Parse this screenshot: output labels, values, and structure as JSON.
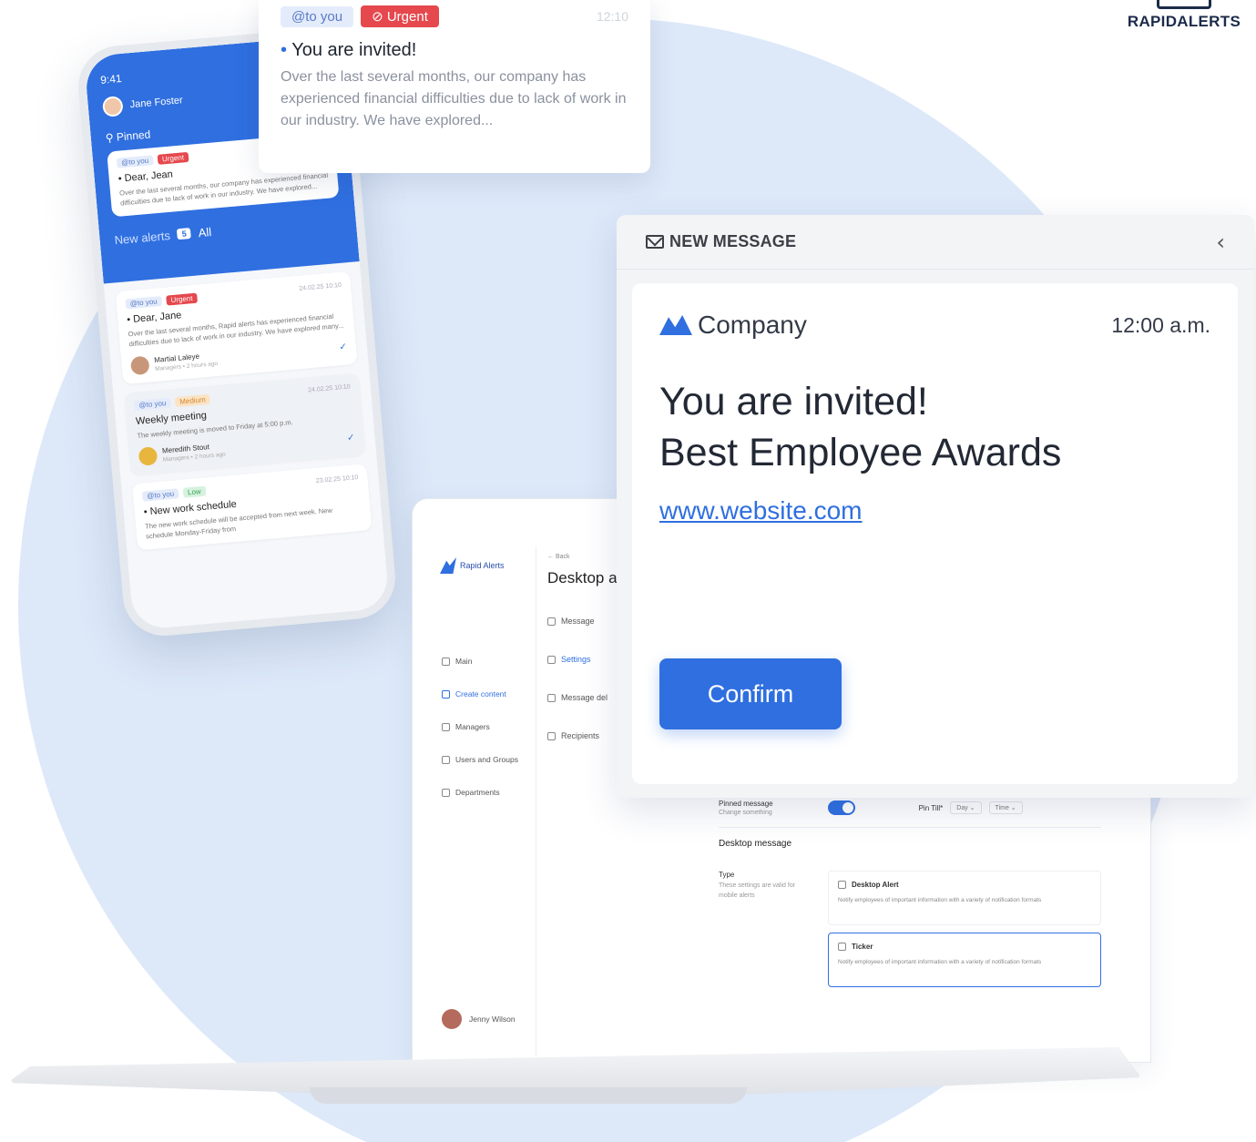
{
  "brand": {
    "name": "RAPIDALERTS"
  },
  "notification": {
    "tag_to": "@to you",
    "tag_urgent": "Urgent",
    "time": "12:10",
    "title": "You are invited!",
    "body": "Over the last several months, our company has experienced financial difficulties due to lack of work in our industry. We have explored..."
  },
  "phone": {
    "time": "9:41",
    "user": "Jane Foster",
    "pinned_label": "Pinned",
    "pinned": {
      "tag_to": "@to you",
      "tag_urgent": "Urgent",
      "title": "Dear, Jean",
      "body": "Over the last several months, our company has experienced financial difficulties due to lack of work in our industry. We have explored..."
    },
    "new_alerts_label": "New alerts",
    "new_alerts_count": "5",
    "all_label": "All",
    "alerts": [
      {
        "tag_to": "@to you",
        "tag_level": "Urgent",
        "date": "24.02.25 10:10",
        "title": "Dear, Jane",
        "body": "Over the last several months, Rapid alerts has experienced financial difficulties due to lack of work in our industry. We have explored many...",
        "author": "Martial Laleye",
        "author_meta": "Managers • 2 hours ago"
      },
      {
        "tag_to": "@to you",
        "tag_level": "Medium",
        "date": "24.02.25 10:10",
        "title": "Weekly meeting",
        "body": "The weekly meeting is moved to Friday at 5:00 p.m.",
        "author": "Meredith Stout",
        "author_meta": "Managers • 2 hours ago"
      },
      {
        "tag_to": "@to you",
        "tag_level": "Low",
        "date": "23.02.25 10:10",
        "title": "New work schedule",
        "body": "The new work schedule will be accepted from next week. New schedule Monday-Friday from"
      }
    ]
  },
  "laptop": {
    "logo": "Rapid Alerts",
    "nav": [
      "Main",
      "Create content",
      "Managers",
      "Users and Groups",
      "Departments"
    ],
    "user": "Jenny Wilson",
    "back": "← Back",
    "heading": "Desktop a",
    "sub_nav": [
      "Message",
      "Settings",
      "Message del",
      "Recipients"
    ],
    "pinned_message": "Pinned message",
    "change_something": "Change something",
    "pin_till": "Pin Till*",
    "day": "Day",
    "time": "Time",
    "section_title": "Desktop message",
    "type_label": "Type",
    "type_note": "These settings are valid for mobile alerts",
    "options": [
      {
        "title": "Desktop Alert",
        "desc": "Notify employees of important information with a variety of notification formats"
      },
      {
        "title": "Ticker",
        "desc": "Notify employees of important information with a variety of notification formats"
      }
    ]
  },
  "new_message": {
    "header": "NEW MESSAGE",
    "company": "Company",
    "time": "12:00 a.m.",
    "title_line1": "You are invited!",
    "title_line2": "Best Employee Awards",
    "link": "www.website.com",
    "confirm": "Confirm"
  },
  "colors": {
    "accent": "#2f6fe0",
    "urgent": "#e5484d",
    "background_circle": "#dde9f9"
  }
}
